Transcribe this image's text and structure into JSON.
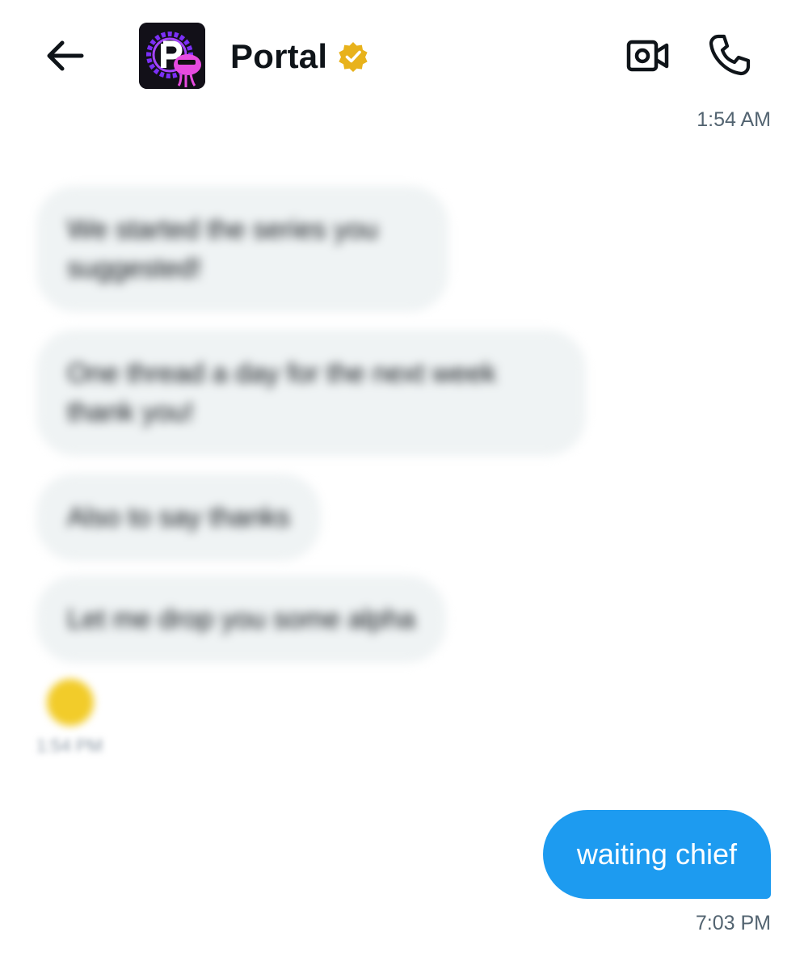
{
  "header": {
    "back_icon": "arrow-left-icon",
    "title": "Portal",
    "verified_icon": "verified-badge-icon",
    "video_icon": "video-camera-icon",
    "call_icon": "phone-icon"
  },
  "conversation": {
    "top_timestamp": "1:54 AM",
    "received_messages": [
      {
        "text": "We started the series you suggested!"
      },
      {
        "text": "One thread a day for the next week thank you!"
      },
      {
        "text": "Also to say thanks"
      },
      {
        "text": "Let me drop you some alpha"
      }
    ],
    "reaction_icon": "emoji-reaction-icon",
    "received_time": "1:54 PM",
    "sent_message": "waiting chief",
    "sent_timestamp": "7:03 PM"
  },
  "colors": {
    "sent_bubble": "#1d9bf0",
    "received_bubble": "#eff3f4",
    "verified_gold": "#e8b21b",
    "timestamp": "#536471"
  }
}
